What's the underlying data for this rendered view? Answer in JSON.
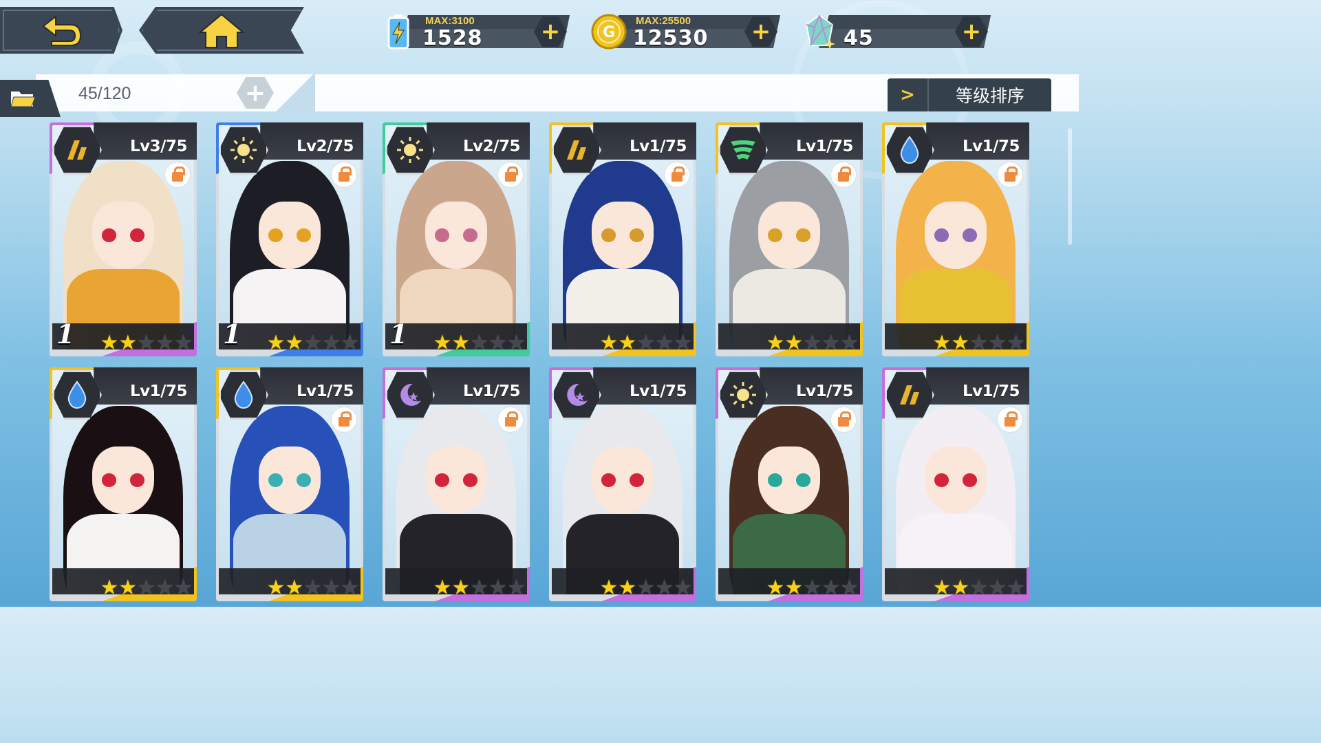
{
  "resources": [
    {
      "icon": "energy-battery-icon",
      "max": "MAX:3100",
      "value": "1528"
    },
    {
      "icon": "gold-coin-icon",
      "max": "MAX:25500",
      "value": "12530"
    },
    {
      "icon": "crystal-gem-icon",
      "max": "",
      "value": "45"
    }
  ],
  "folder": {
    "count": "45/120"
  },
  "sort": {
    "label": "等级排序"
  },
  "cards": [
    {
      "level": "Lv3/75",
      "element": "earth",
      "locked": true,
      "rank": "1",
      "stars": 2,
      "frame": "#c46ee0",
      "hair": "#f1e0c8",
      "eye": "#d2243a",
      "outfit": "#e8a533"
    },
    {
      "level": "Lv2/75",
      "element": "light",
      "locked": true,
      "rank": "1",
      "stars": 2,
      "frame": "#3f7ee8",
      "hair": "#1d1d26",
      "eye": "#e3a321",
      "outfit": "#f5f3f3"
    },
    {
      "level": "Lv2/75",
      "element": "light",
      "locked": true,
      "rank": "1",
      "stars": 2,
      "frame": "#3fcb9a",
      "hair": "#c9a68c",
      "eye": "#c76b8e",
      "outfit": "#f0d7c0"
    },
    {
      "level": "Lv1/75",
      "element": "earth",
      "locked": true,
      "rank": "",
      "stars": 2,
      "frame": "#f2c21e",
      "hair": "#203a8e",
      "eye": "#d69a2e",
      "outfit": "#f3efe9"
    },
    {
      "level": "Lv1/75",
      "element": "wind",
      "locked": true,
      "rank": "",
      "stars": 2,
      "frame": "#f2c21e",
      "hair": "#9b9ea3",
      "eye": "#d9a128",
      "outfit": "#ece9e3"
    },
    {
      "level": "Lv1/75",
      "element": "water",
      "locked": true,
      "rank": "",
      "stars": 2,
      "frame": "#f2c21e",
      "hair": "#f4b24b",
      "eye": "#8a6bb5",
      "outfit": "#e6c233"
    },
    {
      "level": "Lv1/75",
      "element": "water",
      "locked": false,
      "rank": "",
      "stars": 2,
      "frame": "#f2c21e",
      "hair": "#1a1014",
      "eye": "#d2243a",
      "outfit": "#f5f2f2"
    },
    {
      "level": "Lv1/75",
      "element": "water",
      "locked": true,
      "rank": "",
      "stars": 2,
      "frame": "#f2c21e",
      "hair": "#2750b8",
      "eye": "#3ab0b5",
      "outfit": "#b9d2e6"
    },
    {
      "level": "Lv1/75",
      "element": "dark",
      "locked": true,
      "rank": "",
      "stars": 2,
      "frame": "#c46ee0",
      "hair": "#e7e9ec",
      "eye": "#d2243a",
      "outfit": "#25232a"
    },
    {
      "level": "Lv1/75",
      "element": "dark",
      "locked": false,
      "rank": "",
      "stars": 2,
      "frame": "#c46ee0",
      "hair": "#e7e9ec",
      "eye": "#d2243a",
      "outfit": "#25232a"
    },
    {
      "level": "Lv1/75",
      "element": "light",
      "locked": true,
      "rank": "",
      "stars": 2,
      "frame": "#c46ee0",
      "hair": "#4a2e22",
      "eye": "#2aa89a",
      "outfit": "#3c6a44"
    },
    {
      "level": "Lv1/75",
      "element": "earth",
      "locked": true,
      "rank": "",
      "stars": 2,
      "frame": "#c46ee0",
      "hair": "#f3eef3",
      "eye": "#d2243a",
      "outfit": "#f7f2f7"
    }
  ]
}
